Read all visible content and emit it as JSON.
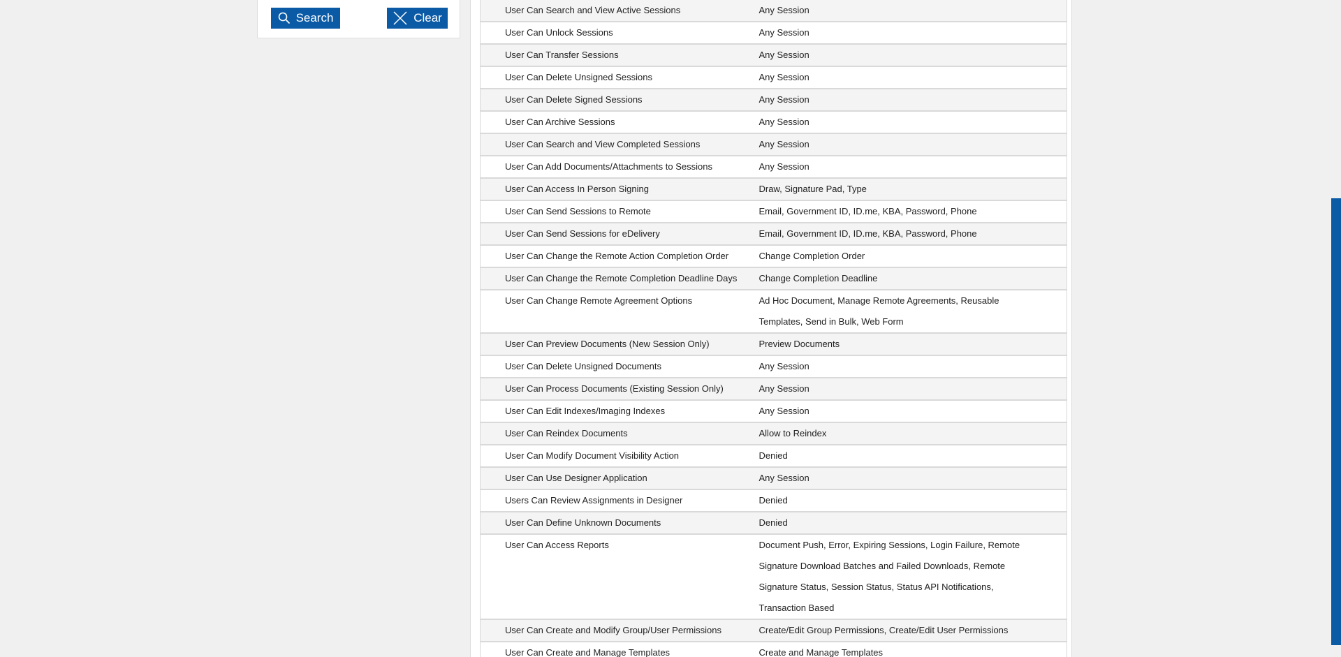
{
  "sidebar": {
    "search_label": "Search",
    "clear_label": "Clear"
  },
  "permissions": [
    {
      "permission": "User Can Search and View Active Sessions",
      "value": "Any Session"
    },
    {
      "permission": "User Can Unlock Sessions",
      "value": "Any Session"
    },
    {
      "permission": "User Can Transfer Sessions",
      "value": "Any Session"
    },
    {
      "permission": "User Can Delete Unsigned Sessions",
      "value": "Any Session"
    },
    {
      "permission": "User Can Delete Signed Sessions",
      "value": "Any Session"
    },
    {
      "permission": "User Can Archive Sessions",
      "value": "Any Session"
    },
    {
      "permission": "User Can Search and View Completed Sessions",
      "value": "Any Session"
    },
    {
      "permission": "User Can Add Documents/Attachments to Sessions",
      "value": "Any Session"
    },
    {
      "permission": "User Can Access In Person Signing",
      "value": "Draw, Signature Pad, Type"
    },
    {
      "permission": "User Can Send Sessions to Remote",
      "value": "Email, Government ID, ID.me, KBA, Password, Phone"
    },
    {
      "permission": "User Can Send Sessions for eDelivery",
      "value": "Email, Government ID, ID.me, KBA, Password, Phone"
    },
    {
      "permission": "User Can Change the Remote Action Completion Order",
      "value": "Change Completion Order"
    },
    {
      "permission": "User Can Change the Remote Completion Deadline Days",
      "value": "Change Completion Deadline"
    },
    {
      "permission": "User Can Change Remote Agreement Options",
      "value": "Ad Hoc Document, Manage Remote Agreements, Reusable Templates, Send in Bulk, Web Form"
    },
    {
      "permission": "User Can Preview Documents (New Session Only)",
      "value": "Preview Documents"
    },
    {
      "permission": "User Can Delete Unsigned Documents",
      "value": "Any Session"
    },
    {
      "permission": "User Can Process Documents (Existing Session Only)",
      "value": "Any Session"
    },
    {
      "permission": "User Can Edit Indexes/Imaging Indexes",
      "value": "Any Session"
    },
    {
      "permission": "User Can Reindex Documents",
      "value": "Allow to Reindex"
    },
    {
      "permission": "User Can Modify Document Visibility Action",
      "value": "Denied"
    },
    {
      "permission": "User Can Use Designer Application",
      "value": "Any Session"
    },
    {
      "permission": "Users Can Review Assignments in Designer",
      "value": "Denied"
    },
    {
      "permission": "User Can Define Unknown Documents",
      "value": "Denied"
    },
    {
      "permission": "User Can Access Reports",
      "value": "Document Push, Error, Expiring Sessions, Login Failure, Remote Signature Download Batches and Failed Downloads, Remote Signature Status, Session Status, Status API Notifications, Transaction Based"
    },
    {
      "permission": "User Can Create and Modify Group/User Permissions",
      "value": "Create/Edit Group Permissions, Create/Edit User Permissions"
    },
    {
      "permission": "User Can Create and Manage Templates",
      "value": "Create and Manage Templates"
    }
  ]
}
